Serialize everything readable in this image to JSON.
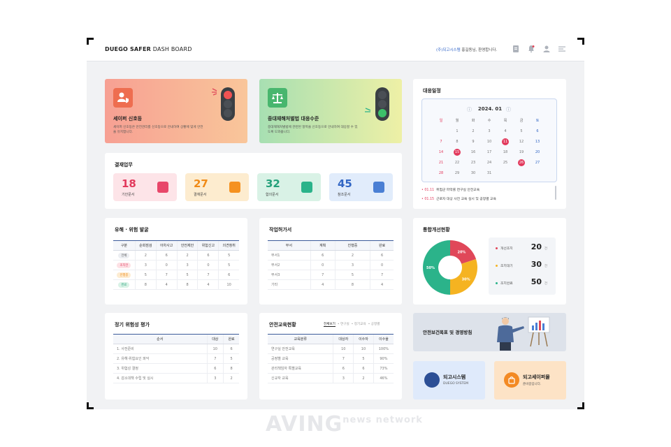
{
  "brand": {
    "bold": "DUEGO SAFER",
    "rest": " DASH BOARD"
  },
  "header": {
    "company": "(주)되고시스템",
    "greeting": " 홍길동님, 환영합니다."
  },
  "hero1": {
    "title": "세이퍼 신호등",
    "desc": "세이퍼 신호등은 안전관리를 신호등으로 안내하여 상황에 맞게 안전을 유지합니다."
  },
  "hero2": {
    "title": "중대재해처벌법 대응수준",
    "desc": "중대재해처벌법에 관련된 항목을 신호등으로 안내하여 대응할 수 있도록 도와줍니다."
  },
  "approval": {
    "title": "결재업무",
    "items": [
      {
        "num": "18",
        "label": "기안문서"
      },
      {
        "num": "27",
        "label": "결재문서"
      },
      {
        "num": "32",
        "label": "합의문서"
      },
      {
        "num": "45",
        "label": "참조문서"
      }
    ]
  },
  "calendar": {
    "title": "대응일정",
    "month": "2024. 01",
    "dow": [
      "일",
      "월",
      "화",
      "수",
      "목",
      "금",
      "토"
    ],
    "weeks": [
      [
        "",
        "1",
        "2",
        "3",
        "4",
        "5",
        "6"
      ],
      [
        "7",
        "8",
        "9",
        "10",
        "11",
        "12",
        "13"
      ],
      [
        "14",
        "15",
        "16",
        "17",
        "18",
        "19",
        "20"
      ],
      [
        "21",
        "22",
        "23",
        "24",
        "25",
        "26",
        "27"
      ],
      [
        "28",
        "29",
        "30",
        "31",
        "",
        "",
        ""
      ]
    ],
    "schedule": [
      {
        "date": "01.11",
        "text": "위험군 파악률 연구실 안전교육"
      },
      {
        "date": "01.15",
        "text": "근로자 대상 사전 교육 실시 및 공정별 교육"
      }
    ]
  },
  "hazard": {
    "title": "유해 · 위험 발굴",
    "headers": [
      "구분",
      "순회점검",
      "아차사고",
      "안전제안",
      "위험신고",
      "의견청취"
    ],
    "rows": [
      [
        "전체",
        "2",
        "6",
        "2",
        "6",
        "5"
      ],
      [
        "조치전",
        "3",
        "0",
        "3",
        "0",
        "5"
      ],
      [
        "진행중",
        "5",
        "7",
        "5",
        "7",
        "6"
      ],
      [
        "완료",
        "8",
        "4",
        "8",
        "4",
        "10"
      ]
    ]
  },
  "permit": {
    "title": "작업허가서",
    "headers": [
      "부서",
      "계획",
      "진행중",
      "완료"
    ],
    "rows": [
      [
        "부서1",
        "6",
        "2",
        "6"
      ],
      [
        "부서2",
        "0",
        "3",
        "0"
      ],
      [
        "부서3",
        "7",
        "5",
        "7"
      ],
      [
        "기타",
        "4",
        "8",
        "4"
      ]
    ]
  },
  "improve": {
    "title": "통합개선현황",
    "slices": [
      {
        "label": "20%",
        "value": 20,
        "color": "#e04759"
      },
      {
        "label": "30%",
        "value": 30,
        "color": "#f5b321"
      },
      {
        "label": "50%",
        "value": 50,
        "color": "#2bb38a"
      }
    ],
    "legend": [
      {
        "label": "개선조치",
        "num": "20",
        "unit": "건",
        "color": "#e04759"
      },
      {
        "label": "조치대기",
        "num": "30",
        "unit": "건",
        "color": "#f5b321"
      },
      {
        "label": "조치완료",
        "num": "50",
        "unit": "건",
        "color": "#2bb38a"
      }
    ]
  },
  "risk": {
    "title": "정기 위험성 평가",
    "headers": [
      "순서",
      "대상",
      "완료"
    ],
    "rows": [
      [
        "1. 사전준비",
        "10",
        "6"
      ],
      [
        "2. 유해·위험요인 파악",
        "7",
        "5"
      ],
      [
        "3. 위험성 결정",
        "6",
        "8"
      ],
      [
        "4. 감소대책 수립 및 실시",
        "3",
        "2"
      ]
    ]
  },
  "edu": {
    "title": "안전교육현황",
    "tabs": [
      "전체보기",
      "연구실",
      "정기교육",
      "공정별"
    ],
    "headers": [
      "교육분류",
      "대상자",
      "이수자",
      "이수율"
    ],
    "rows": [
      [
        "연구실 안전교육",
        "10",
        "10",
        "100%"
      ],
      [
        "공정별 교육",
        "7",
        "5",
        "90%"
      ],
      [
        "관리책임자 특별교육",
        "6",
        "6",
        "73%"
      ],
      [
        "신규자 교육",
        "3",
        "2",
        "46%"
      ]
    ]
  },
  "policy": {
    "title": "안전보건목표 및 경영방침"
  },
  "system": {
    "title": "되고시스템",
    "sub": "DUEGO SYSTEM"
  },
  "safer": {
    "title": "되고세이퍼몰",
    "sub": "준비중입니다."
  },
  "watermark": {
    "main": "AVING",
    "news": "news",
    "network": "network"
  },
  "colors": {
    "accent": "#3b5b9a",
    "red": "#e04759",
    "orange": "#f5b321",
    "green": "#2bb38a",
    "blue": "#4a7fd4"
  }
}
